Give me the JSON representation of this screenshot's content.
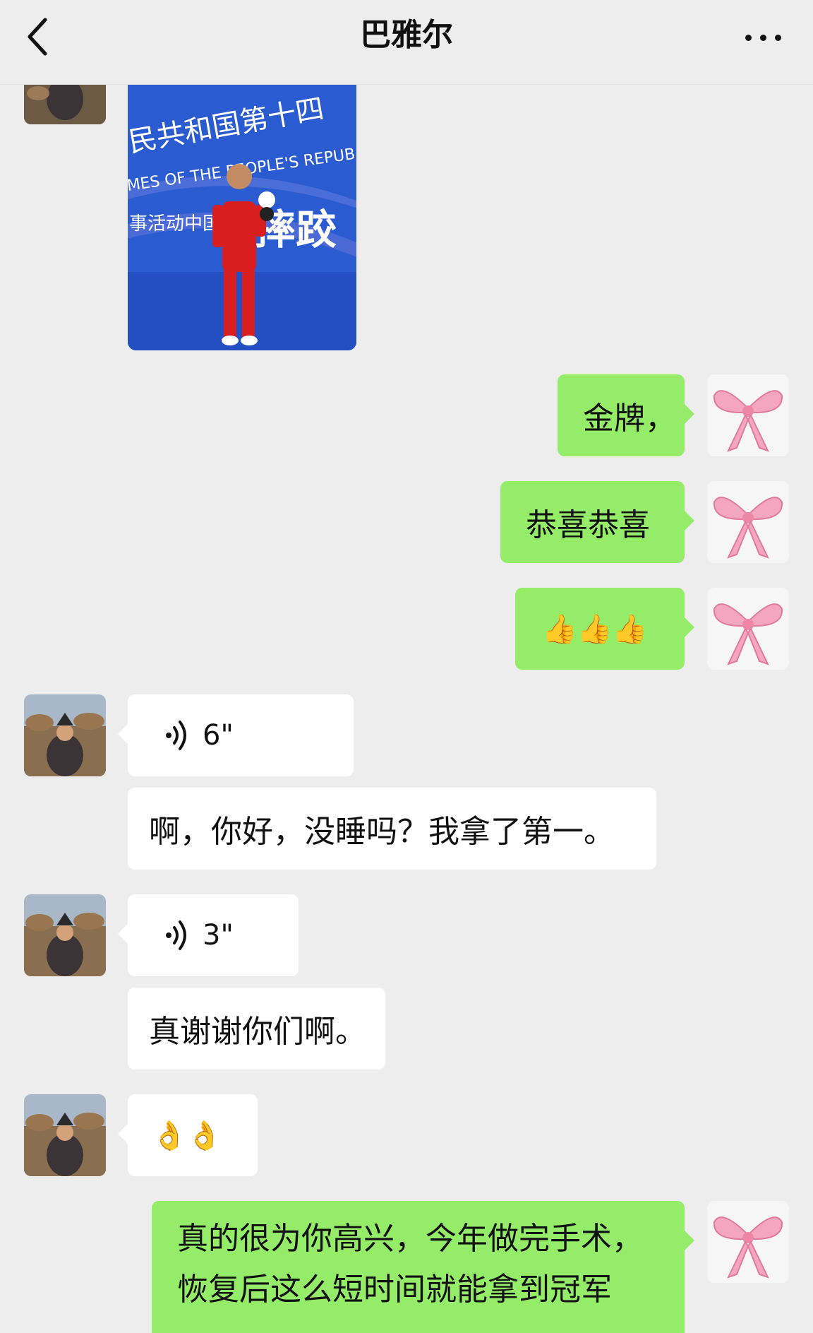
{
  "header": {
    "title": "巴雅尔",
    "back_icon": "chevron-left-icon",
    "more_icon": "more-dots-icon"
  },
  "colors": {
    "background": "#ededed",
    "incoming_bubble": "#ffffff",
    "outgoing_bubble": "#95ec69"
  },
  "photo": {
    "banner_line1": "民共和国第十四",
    "banner_line2": "MES OF THE PEOPLE'S REPUB",
    "banner_line3": "事活动中国",
    "banner_line4": "摔跤"
  },
  "messages": [
    {
      "id": "m1",
      "side": "right",
      "type": "text",
      "text": "金牌，"
    },
    {
      "id": "m2",
      "side": "right",
      "type": "text",
      "text": "恭喜恭喜"
    },
    {
      "id": "m3",
      "side": "right",
      "type": "emoji",
      "text": "👍👍👍",
      "icon": "thumbs-up-icon"
    },
    {
      "id": "m4",
      "side": "left",
      "type": "voice",
      "duration": "6\"",
      "icon": "voice-icon"
    },
    {
      "id": "m5",
      "side": "left",
      "type": "text",
      "text": "啊，你好，没睡吗？我拿了第一。"
    },
    {
      "id": "m6",
      "side": "left",
      "type": "voice",
      "duration": "3\"",
      "icon": "voice-icon"
    },
    {
      "id": "m7",
      "side": "left",
      "type": "text",
      "text": "真谢谢你们啊。"
    },
    {
      "id": "m8",
      "side": "left",
      "type": "emoji",
      "text": "👌👌",
      "icon": "ok-hand-icon"
    },
    {
      "id": "m9",
      "side": "right",
      "type": "text",
      "text": "真的很为你高兴，今年做完手术，恢复后这么短时间就能拿到冠军"
    }
  ]
}
